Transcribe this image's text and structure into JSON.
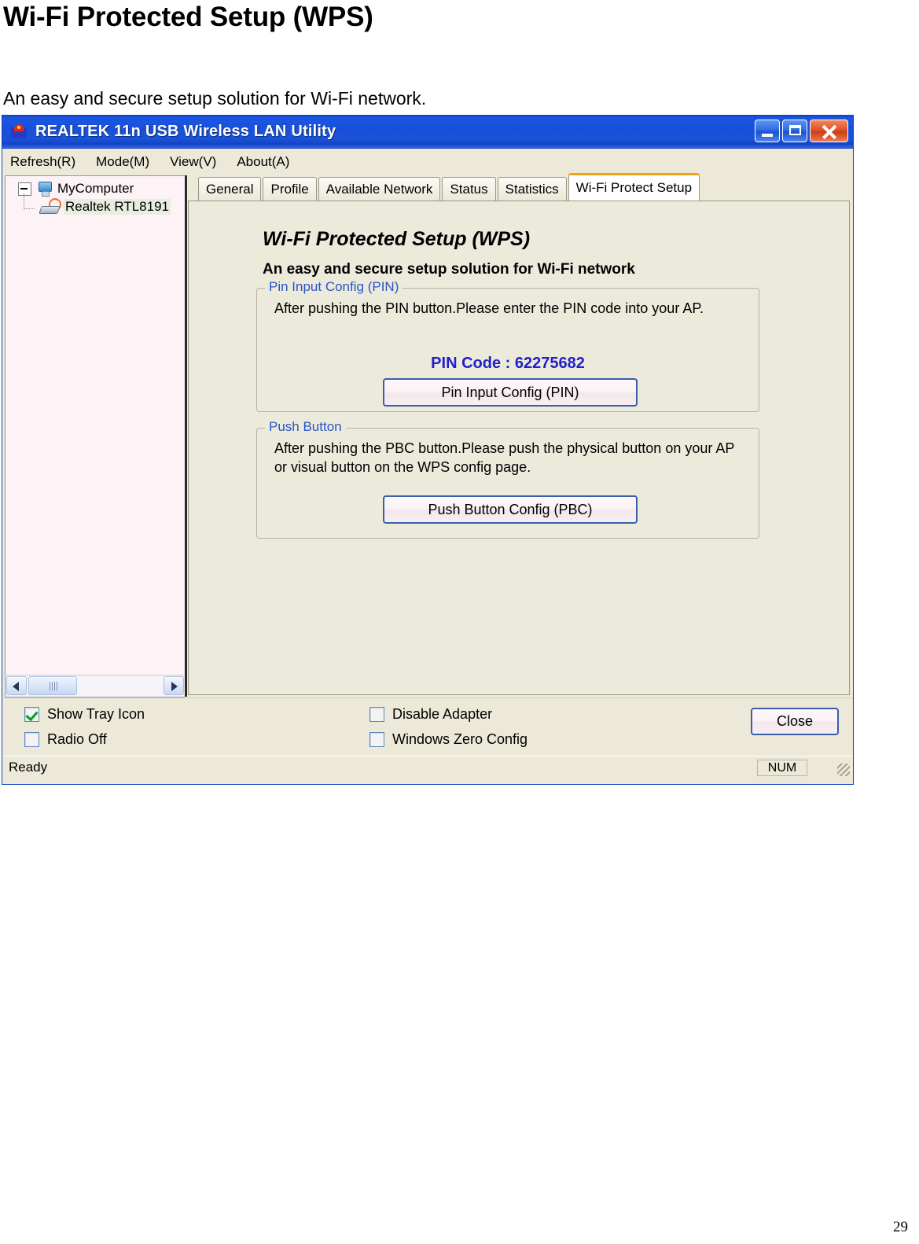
{
  "document": {
    "title": "Wi-Fi Protected Setup (WPS)",
    "subtitle": "An easy and secure setup solution for Wi-Fi network.",
    "page_number": "29"
  },
  "window": {
    "title": "REALTEK 11n USB Wireless LAN Utility",
    "icon": "realtek-logo-icon",
    "controls": {
      "minimize": "minimize-icon",
      "maximize": "maximize-icon",
      "close": "close-icon"
    }
  },
  "menu": {
    "items": [
      {
        "label": "Refresh(R)"
      },
      {
        "label": "Mode(M)"
      },
      {
        "label": "View(V)"
      },
      {
        "label": "About(A)"
      }
    ]
  },
  "tree": {
    "root": {
      "label": "MyComputer",
      "icon": "computer-icon",
      "expanded": true
    },
    "child": {
      "label": "Realtek RTL8191",
      "icon": "wireless-adapter-icon",
      "selected": true
    },
    "scrollbar": {
      "left_arrow": "chevron-left-icon",
      "right_arrow": "chevron-right-icon"
    }
  },
  "tabs": [
    {
      "label": "General",
      "active": false
    },
    {
      "label": "Profile",
      "active": false
    },
    {
      "label": "Available Network",
      "active": false
    },
    {
      "label": "Status",
      "active": false
    },
    {
      "label": "Statistics",
      "active": false
    },
    {
      "label": "Wi-Fi Protect Setup",
      "active": true
    }
  ],
  "panel": {
    "title": "Wi-Fi Protected Setup (WPS)",
    "subtitle": "An easy and secure setup solution for Wi-Fi network",
    "pin_group": {
      "legend": "Pin Input Config (PIN)",
      "description": "After pushing the PIN button.Please enter the PIN code into your AP.",
      "pin_code_label": "PIN Code :  62275682",
      "button_label": "Pin Input Config (PIN)"
    },
    "pbc_group": {
      "legend": "Push Button",
      "description": "After pushing the PBC button.Please push the physical button on your AP or visual button on the WPS config page.",
      "button_label": "Push Button Config (PBC)"
    }
  },
  "bottom": {
    "checkboxes": [
      {
        "label": "Show Tray Icon",
        "checked": true
      },
      {
        "label": "Radio Off",
        "checked": false
      },
      {
        "label": "Disable Adapter",
        "checked": false
      },
      {
        "label": "Windows Zero Config",
        "checked": false
      }
    ],
    "close_button": "Close"
  },
  "statusbar": {
    "message": "Ready",
    "num_indicator": "NUM",
    "grip": "resize-grip-icon"
  },
  "colors": {
    "titlebar_blue": "#1a52d8",
    "panel_cream": "#eceadb",
    "tree_panel": "#fdf2f5",
    "pin_code_blue": "#2020cc",
    "legend_blue": "#2a54c8",
    "active_tab_accent": "#f0a318",
    "check_green": "#0a9a28"
  }
}
